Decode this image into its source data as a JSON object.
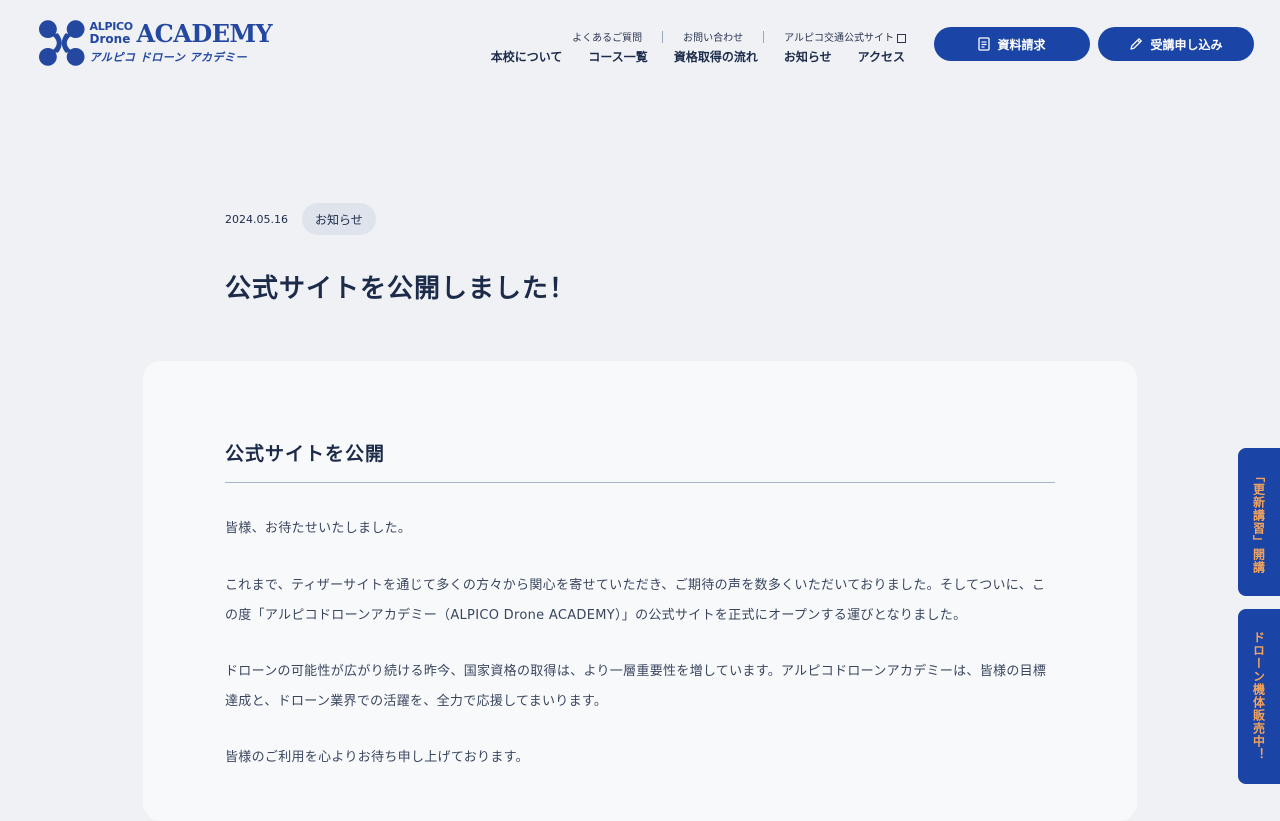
{
  "logo": {
    "alpico": "ALPICO",
    "drone": "Drone",
    "academy": "ACADEMY",
    "kana": "アルピコ ドローン アカデミー",
    "brand_color": "#2447a0"
  },
  "subnav": {
    "faq": "よくあるご質問",
    "contact": "お問い合わせ",
    "official_site": "アルピコ交通公式サイト"
  },
  "mainnav": {
    "about": "本校について",
    "courses": "コース一覧",
    "flow": "資格取得の流れ",
    "news": "お知らせ",
    "access": "アクセス"
  },
  "buttons": {
    "document_request": "資料請求",
    "apply": "受講申し込み",
    "color": "#1a44a6"
  },
  "article": {
    "date": "2024.05.16",
    "category": "お知らせ",
    "title": "公式サイトを公開しました！",
    "section_heading": "公式サイトを公開",
    "paragraphs": [
      "皆様、お待たせいたしました。",
      "これまで、ティザーサイトを通じて多くの方々から関心を寄せていただき、ご期待の声を数多くいただいておりました。そしてついに、この度「アルピコドローンアカデミー（ALPICO Drone ACADEMY）」の公式サイトを正式にオープンする運びとなりました。",
      "ドローンの可能性が広がり続ける昨今、国家資格の取得は、より一層重要性を増しています。アルピコドローンアカデミーは、皆様の目標達成と、ドローン業界での活躍を、全力で応援してまいります。",
      "皆様のご利用を心よりお待ち申し上げております。"
    ]
  },
  "side_tabs": {
    "renewal": "「更新講習」開講",
    "sales": "ドローン機体販売中！",
    "text_color": "#f3a35c"
  }
}
